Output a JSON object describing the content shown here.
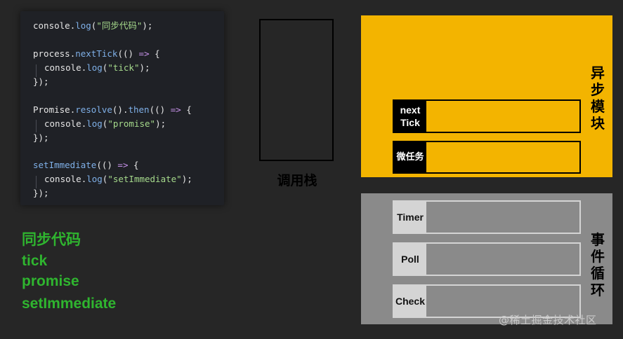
{
  "code": {
    "line1": [
      "console",
      ".",
      "log",
      "(",
      "\"同步代码\"",
      ");"
    ],
    "line3": [
      "process",
      ".",
      "nextTick",
      "((",
      ")",
      " => ",
      "{"
    ],
    "line4": [
      "console",
      ".",
      "log",
      "(",
      "\"tick\"",
      ");"
    ],
    "line5": "});",
    "line7": [
      "Promise",
      ".",
      "resolve",
      "().",
      "then",
      "((",
      ")",
      " => ",
      "{"
    ],
    "line8": [
      "console",
      ".",
      "log",
      "(",
      "\"promise\"",
      ");"
    ],
    "line9": "});",
    "line11": [
      "setImmediate",
      "((",
      ")",
      " => ",
      "{"
    ],
    "line12": [
      "console",
      ".",
      "log",
      "(",
      "\"setImmediate\"",
      ");"
    ],
    "line13": "});"
  },
  "output": {
    "sync": "同步代码",
    "tick": "tick",
    "promise": "promise",
    "immediate": "setImmediate"
  },
  "callstack": {
    "label": "调用栈"
  },
  "async_module": {
    "label_chars": [
      "异",
      "步",
      "模",
      "块"
    ],
    "queues": [
      {
        "label_line1": "next",
        "label_line2": "Tick"
      },
      {
        "label": "微任务"
      }
    ]
  },
  "event_loop": {
    "label_chars": [
      "事",
      "件",
      "循",
      "环"
    ],
    "phases": [
      "Timer",
      "Poll",
      "Check"
    ]
  },
  "watermark": "@稀土掘金技术社区",
  "colors": {
    "async_bg": "#f3b400",
    "loop_bg": "#8a8a8a",
    "output_green": "#2fb52f"
  }
}
